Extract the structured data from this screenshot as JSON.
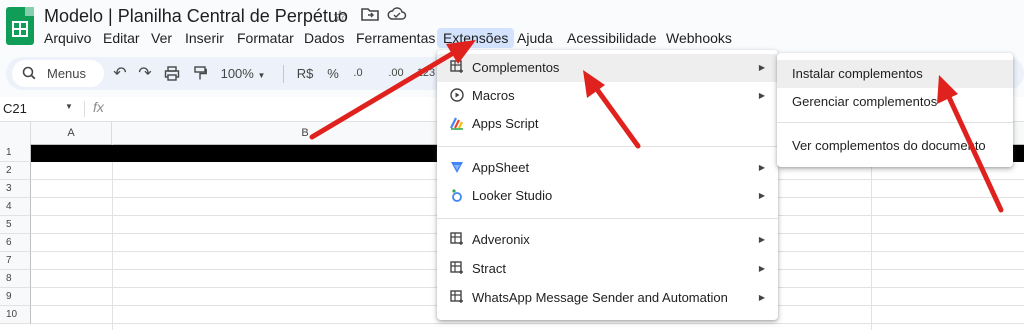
{
  "app": {
    "doc_title": "Modelo | Planilha Central de Perpétuo",
    "menus": [
      "Arquivo",
      "Editar",
      "Ver",
      "Inserir",
      "Formatar",
      "Dados",
      "Ferramentas",
      "Extensões",
      "Ajuda",
      "Acessibilidade",
      "Webhooks"
    ],
    "active_menu": "Extensões"
  },
  "toolbar": {
    "search_label": "Menus",
    "zoom": "100%",
    "currency": "R$",
    "percent": "%",
    "decimal_dec": ".0",
    "decimal_inc": ".00",
    "number_format": "123"
  },
  "formula_bar": {
    "cell_ref": "C21",
    "fx": "fx"
  },
  "grid": {
    "columns": [
      "A",
      "B"
    ],
    "rows": [
      "1",
      "2",
      "3",
      "4",
      "5",
      "6",
      "7",
      "8",
      "9",
      "10"
    ]
  },
  "extensions_menu": {
    "items": [
      {
        "label": "Complementos",
        "icon": "addon-icon",
        "submenu": true
      },
      {
        "label": "Macros",
        "icon": "play-circle-icon",
        "submenu": true
      },
      {
        "label": "Apps Script",
        "icon": "apps-script-icon",
        "submenu": false
      },
      {
        "label": "AppSheet",
        "icon": "appsheet-icon",
        "submenu": true
      },
      {
        "label": "Looker Studio",
        "icon": "looker-studio-icon",
        "submenu": true
      },
      {
        "label": "Adveronix",
        "icon": "addon-icon",
        "submenu": true
      },
      {
        "label": "Stract",
        "icon": "addon-icon",
        "submenu": true
      },
      {
        "label": "WhatsApp Message Sender and Automation",
        "icon": "addon-icon",
        "submenu": true
      }
    ]
  },
  "addons_submenu": {
    "items": [
      {
        "label": "Instalar complementos"
      },
      {
        "label": "Gerenciar complementos"
      },
      {
        "label": "Ver complementos do documento"
      }
    ]
  },
  "colors": {
    "accent": "#d3e3fd",
    "sheets_green": "#0f9d58",
    "arrow_red": "#e0221e"
  }
}
